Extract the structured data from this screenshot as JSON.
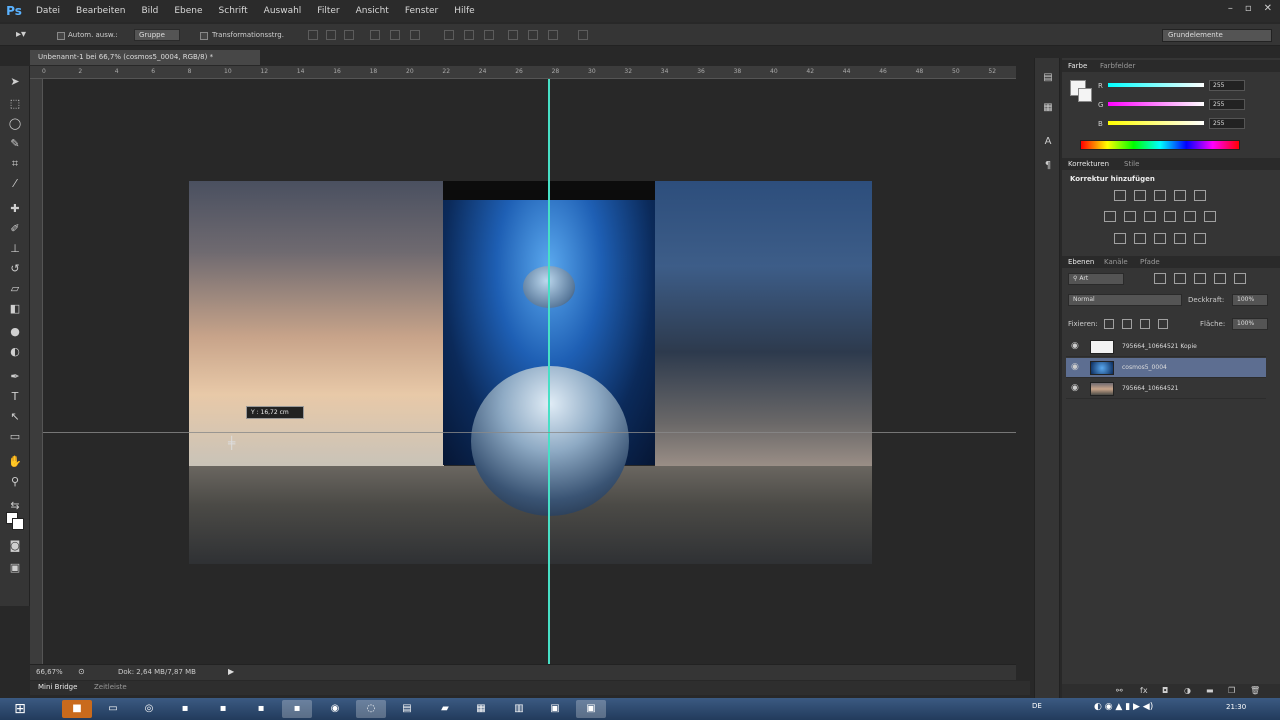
{
  "app": {
    "logo": "Ps"
  },
  "menu": [
    "Datei",
    "Bearbeiten",
    "Bild",
    "Ebene",
    "Schrift",
    "Auswahl",
    "Filter",
    "Ansicht",
    "Fenster",
    "Hilfe"
  ],
  "window_controls": {
    "minimize": "–",
    "maximize": "▫",
    "close": "✕"
  },
  "options": {
    "auto_select_label": "Autom. ausw.:",
    "auto_select_value": "Gruppe",
    "transform_label": "Transformationsstrg.",
    "workspace": "Grundelemente"
  },
  "document": {
    "tab_title": "Unbenannt-1 bei 66,7% (cosmos5_0004, RGB/8) *",
    "zoom": "66,67%",
    "info": "Dok: 2,64 MB/7,87 MB",
    "tooltip": "Y : 16,72 cm"
  },
  "ruler_ticks": [
    "0",
    "2",
    "4",
    "6",
    "8",
    "10",
    "12",
    "14",
    "16",
    "18",
    "20",
    "22",
    "24",
    "26",
    "28",
    "30",
    "32",
    "34",
    "36",
    "38",
    "40",
    "42",
    "44",
    "46",
    "48",
    "50",
    "52"
  ],
  "bottom_tabs": {
    "bridge": "Mini Bridge",
    "timeline": "Zeitleiste"
  },
  "panels": {
    "color": {
      "tab1": "Farbe",
      "tab2": "Farbfelder",
      "r_label": "R",
      "g_label": "G",
      "b_label": "B",
      "r": "255",
      "g": "255",
      "b": "255"
    },
    "adjust": {
      "tab1": "Korrekturen",
      "tab2": "Stile",
      "title": "Korrektur hinzufügen"
    },
    "layers": {
      "tab1": "Ebenen",
      "tab2": "Kanäle",
      "tab3": "Pfade",
      "filter": "Art",
      "blend_mode": "Normal",
      "opacity_label": "Deckkraft:",
      "opacity": "100%",
      "lock_label": "Fixieren:",
      "fill_label": "Fläche:",
      "fill": "100%",
      "items": [
        {
          "name": "795664_10664521 Kopie",
          "selected": false
        },
        {
          "name": "cosmos5_0004",
          "selected": true
        },
        {
          "name": "795664_10664521",
          "selected": false
        }
      ]
    }
  },
  "taskbar": {
    "lang": "DE",
    "clock": "21:30"
  },
  "colors": {
    "guide": "#47e0c6",
    "selected_layer": "#5d6e91",
    "ps_blue": "#5ab2ff"
  }
}
